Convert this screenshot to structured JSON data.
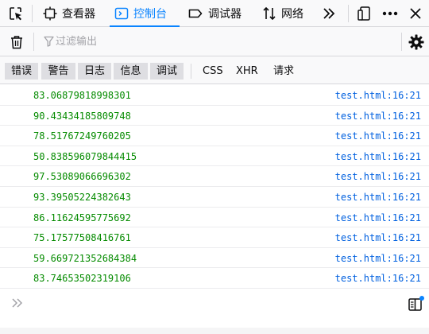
{
  "toolbar": {
    "tabs": [
      {
        "label": "查看器",
        "icon": "inspector-icon"
      },
      {
        "label": "控制台",
        "icon": "console-icon",
        "selected": true
      },
      {
        "label": "调试器",
        "icon": "debugger-icon"
      },
      {
        "label": "网络",
        "icon": "network-icon"
      }
    ]
  },
  "filter": {
    "placeholder": "过滤输出"
  },
  "levels": [
    "错误",
    "警告",
    "日志",
    "信息",
    "调试"
  ],
  "categories": [
    "CSS",
    "XHR",
    "请求"
  ],
  "messages": [
    {
      "value": "83.06879818998301",
      "source": "test.html:16:21"
    },
    {
      "value": "90.43434185809748",
      "source": "test.html:16:21"
    },
    {
      "value": "78.51767249760205",
      "source": "test.html:16:21"
    },
    {
      "value": "50.838596079844415",
      "source": "test.html:16:21"
    },
    {
      "value": "97.53089066696302",
      "source": "test.html:16:21"
    },
    {
      "value": "93.39505224382643",
      "source": "test.html:16:21"
    },
    {
      "value": "86.11624595775692",
      "source": "test.html:16:21"
    },
    {
      "value": "75.17577508416761",
      "source": "test.html:16:21"
    },
    {
      "value": "59.669721352684384",
      "source": "test.html:16:21"
    },
    {
      "value": "83.74653502319106",
      "source": "test.html:16:21"
    }
  ],
  "colors": {
    "accent": "#0a84ff",
    "number": "#058b00",
    "link": "#0060df"
  }
}
